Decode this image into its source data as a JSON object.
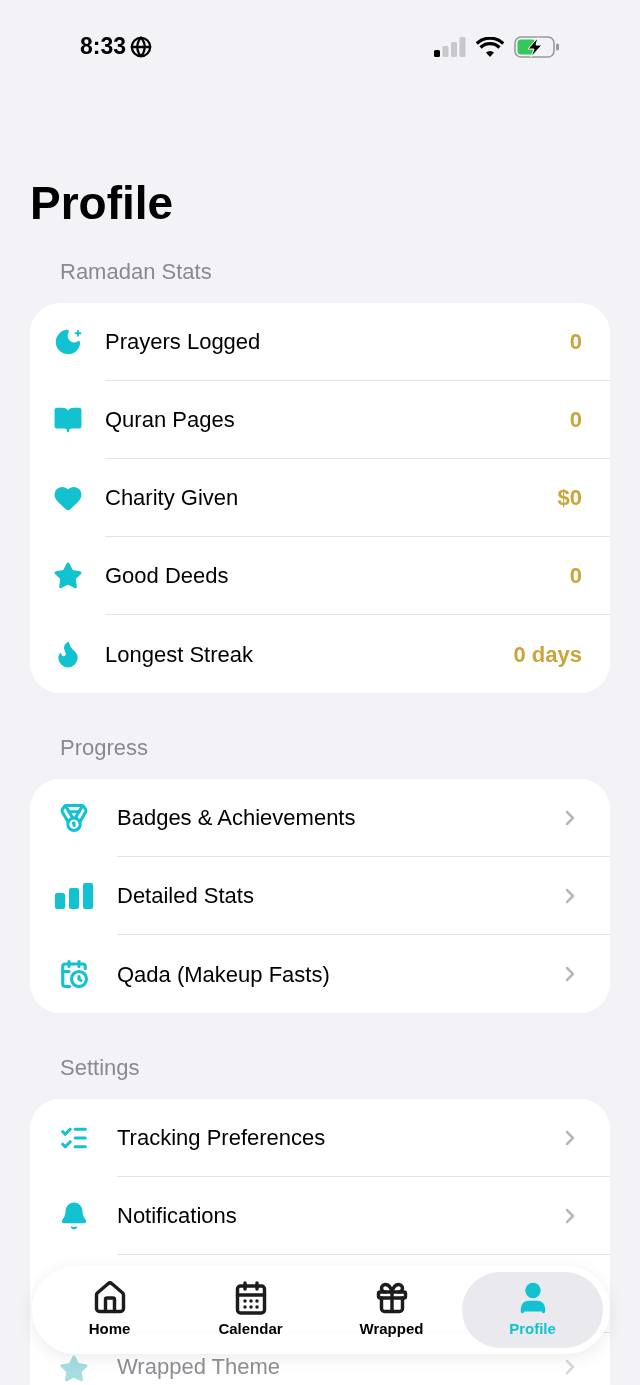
{
  "status_bar": {
    "time": "8:33"
  },
  "title": "Profile",
  "sections": [
    {
      "header": "Ramadan Stats",
      "kind": "stats",
      "rows": [
        {
          "label": "Prayers Logged",
          "value": "0"
        },
        {
          "label": "Quran Pages",
          "value": "0"
        },
        {
          "label": "Charity Given",
          "value": "$0"
        },
        {
          "label": "Good Deeds",
          "value": "0"
        },
        {
          "label": "Longest Streak",
          "value": "0 days"
        }
      ]
    },
    {
      "header": "Progress",
      "kind": "links",
      "rows": [
        {
          "label": "Badges & Achievements"
        },
        {
          "label": "Detailed Stats"
        },
        {
          "label": "Qada (Makeup Fasts)"
        }
      ]
    },
    {
      "header": "Settings",
      "kind": "links",
      "rows": [
        {
          "label": "Tracking Preferences"
        },
        {
          "label": "Notifications"
        },
        {
          "label": "Wrapped Theme",
          "kind": "faded"
        }
      ]
    }
  ],
  "tab_bar": [
    {
      "label": "Home",
      "selected": false
    },
    {
      "label": "Calendar",
      "selected": false
    },
    {
      "label": "Wrapped",
      "selected": false
    },
    {
      "label": "Profile",
      "selected": true
    }
  ]
}
